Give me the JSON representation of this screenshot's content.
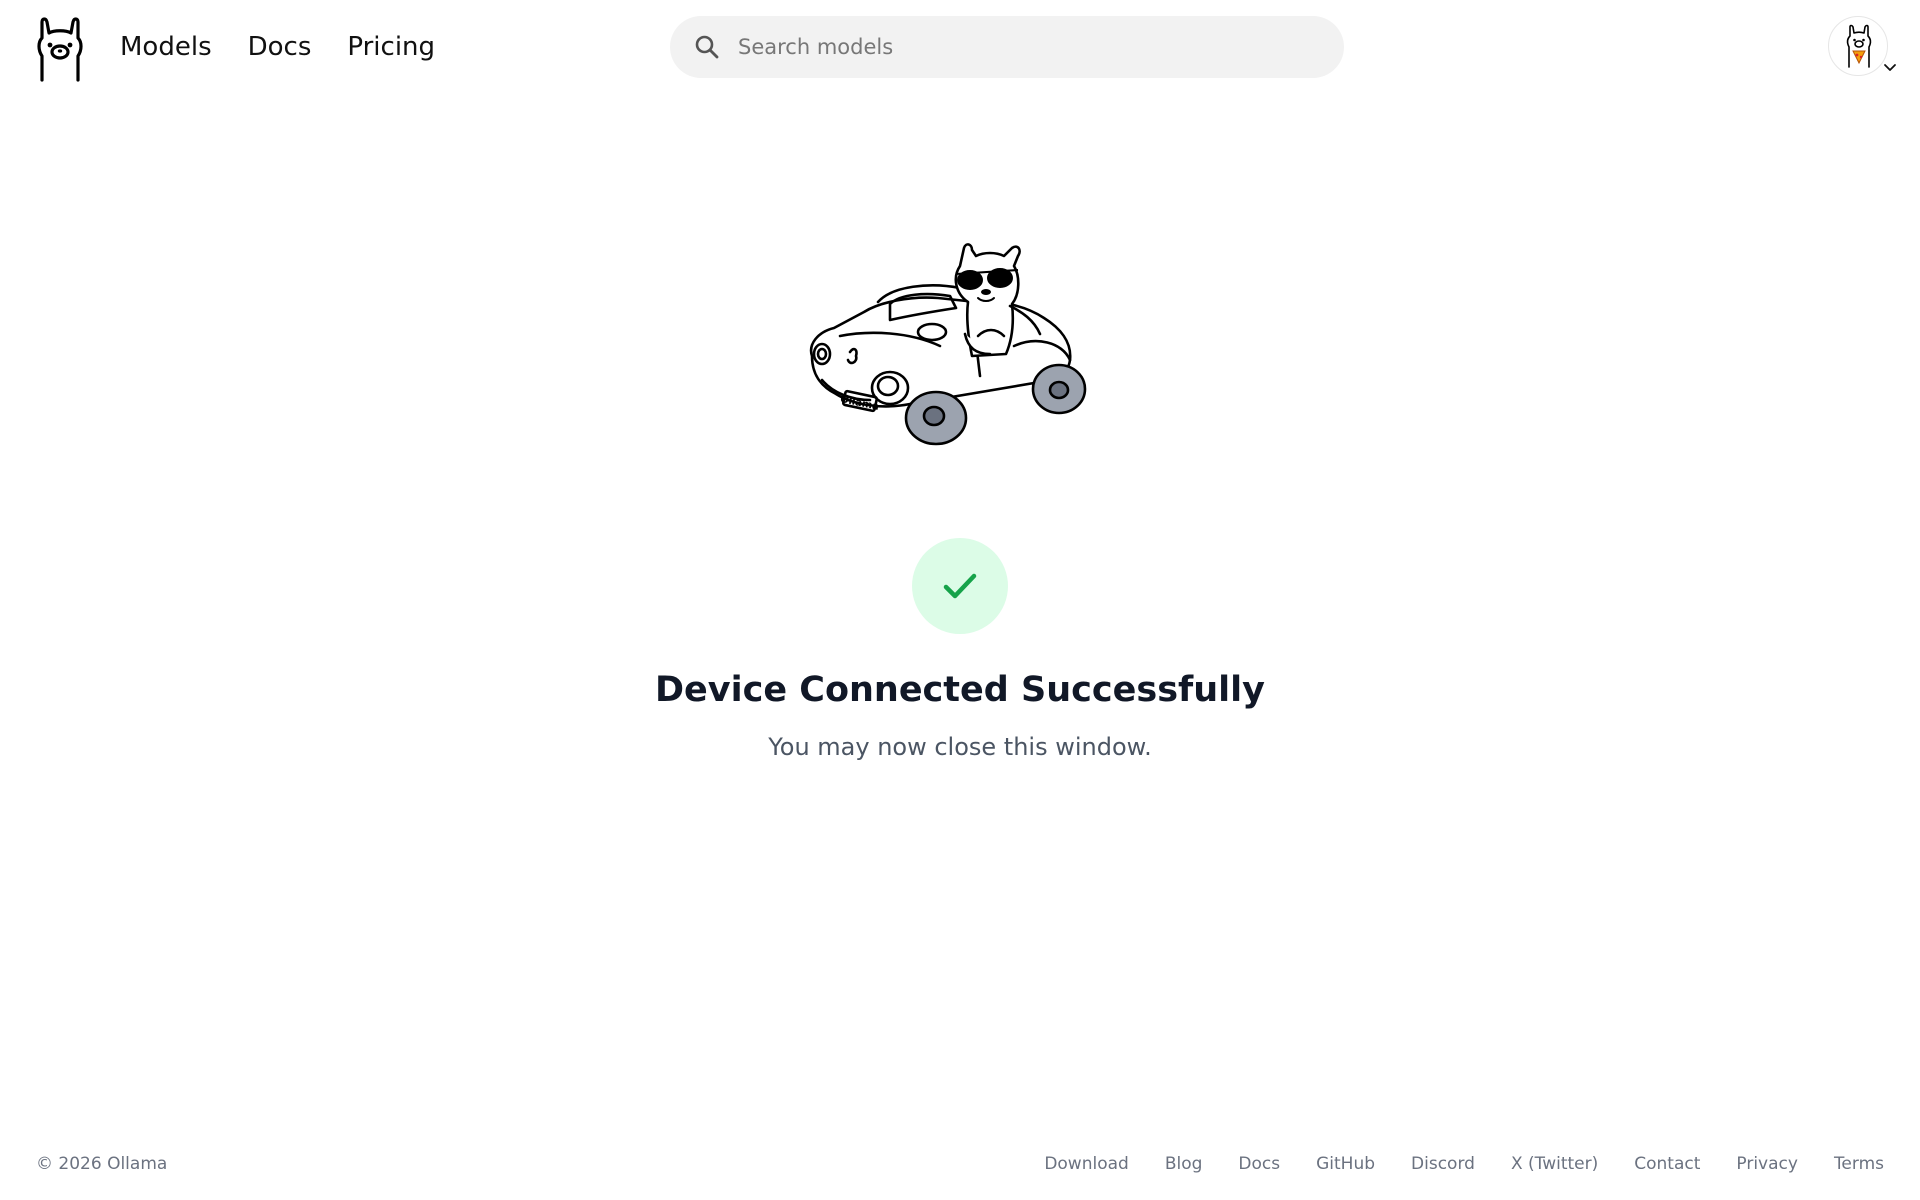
{
  "header": {
    "nav": [
      {
        "label": "Models"
      },
      {
        "label": "Docs"
      },
      {
        "label": "Pricing"
      }
    ],
    "search": {
      "placeholder": "Search models",
      "value": ""
    }
  },
  "main": {
    "plate_text": "Ollama",
    "status_icon": "check-icon",
    "status_color": "#16a34a",
    "status_bg": "#dcfce7",
    "title": "Device Connected Successfully",
    "subtitle": "You may now close this window."
  },
  "footer": {
    "copyright": "© 2026 Ollama",
    "links": [
      {
        "label": "Download"
      },
      {
        "label": "Blog"
      },
      {
        "label": "Docs"
      },
      {
        "label": "GitHub"
      },
      {
        "label": "Discord"
      },
      {
        "label": "X (Twitter)"
      },
      {
        "label": "Contact"
      },
      {
        "label": "Privacy"
      },
      {
        "label": "Terms"
      }
    ]
  }
}
